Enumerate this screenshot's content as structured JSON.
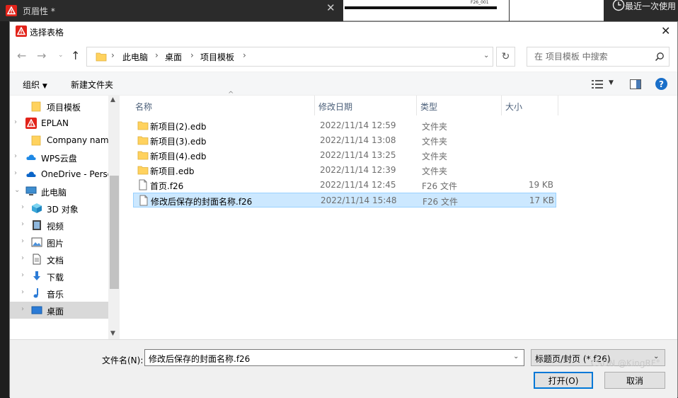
{
  "background": {
    "window_title": "页眉性 *",
    "sheet_label": "F26_001",
    "recent_label": "最近一次使用"
  },
  "dialog": {
    "title": "选择表格",
    "breadcrumb": [
      "此电脑",
      "桌面",
      "项目模板"
    ],
    "search_placeholder": "在 项目模板 中搜索",
    "toolbar": {
      "organize": "组织",
      "new_folder": "新建文件夹"
    }
  },
  "sidebar": {
    "items": [
      {
        "label": "项目模板",
        "icon": "folder-icon",
        "chevron": "",
        "indent": 1
      },
      {
        "label": "EPLAN",
        "icon": "eplan-logo-icon",
        "chevron": "›",
        "indent": 0
      },
      {
        "label": "Company name",
        "icon": "folder-icon",
        "chevron": "",
        "indent": 1
      },
      {
        "label": "WPS云盘",
        "icon": "cloud-icon",
        "chevron": "›",
        "indent": 0
      },
      {
        "label": "OneDrive - Personal",
        "icon": "onedrive-icon",
        "chevron": "›",
        "indent": 0
      },
      {
        "label": "此电脑",
        "icon": "computer-icon",
        "chevron": "⌄",
        "indent": 0
      },
      {
        "label": "3D 对象",
        "icon": "cube-icon",
        "chevron": "›",
        "indent": 1
      },
      {
        "label": "视频",
        "icon": "video-icon",
        "chevron": "›",
        "indent": 1
      },
      {
        "label": "图片",
        "icon": "picture-icon",
        "chevron": "›",
        "indent": 1
      },
      {
        "label": "文档",
        "icon": "document-icon",
        "chevron": "›",
        "indent": 1
      },
      {
        "label": "下载",
        "icon": "download-icon",
        "chevron": "›",
        "indent": 1
      },
      {
        "label": "音乐",
        "icon": "music-icon",
        "chevron": "›",
        "indent": 1
      },
      {
        "label": "桌面",
        "icon": "desktop-icon",
        "chevron": "›",
        "indent": 1,
        "selected": true
      }
    ]
  },
  "columns": {
    "name": "名称",
    "date": "修改日期",
    "type": "类型",
    "size": "大小"
  },
  "files": [
    {
      "name": "新项目(2).edb",
      "date": "2022/11/14 12:59",
      "type": "文件夹",
      "size": "",
      "kind": "folder"
    },
    {
      "name": "新项目(3).edb",
      "date": "2022/11/14 13:08",
      "type": "文件夹",
      "size": "",
      "kind": "folder"
    },
    {
      "name": "新项目(4).edb",
      "date": "2022/11/14 13:25",
      "type": "文件夹",
      "size": "",
      "kind": "folder"
    },
    {
      "name": "新项目.edb",
      "date": "2022/11/14 12:39",
      "type": "文件夹",
      "size": "",
      "kind": "folder"
    },
    {
      "name": "首页.f26",
      "date": "2022/11/14 12:45",
      "type": "F26 文件",
      "size": "19 KB",
      "kind": "file"
    },
    {
      "name": "修改后保存的封面名称.f26",
      "date": "2022/11/14 15:48",
      "type": "F26 文件",
      "size": "17 KB",
      "kind": "file",
      "selected": true
    }
  ],
  "bottom": {
    "filename_label": "文件名(N):",
    "filename_value": "修改后保存的封面名称.f26",
    "filetype_value": "标题页/封页 (*.f26)",
    "open_label": "打开(O)",
    "cancel_label": "取消"
  },
  "watermark": "CSDN @KingRF°",
  "colors": {
    "accent": "#0078d7",
    "selection": "#cce8ff",
    "folder": "#ffd25e",
    "eplan": "#e2231a"
  }
}
